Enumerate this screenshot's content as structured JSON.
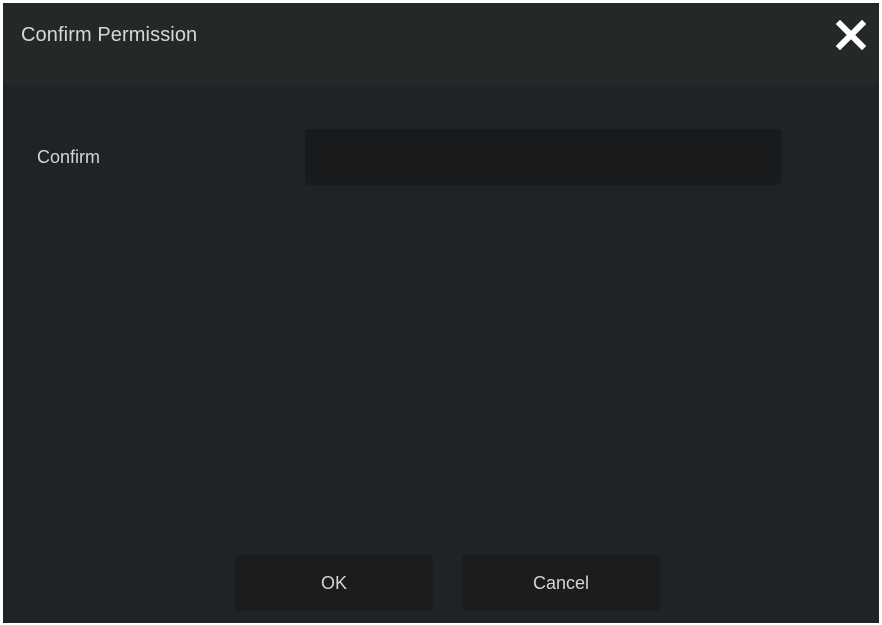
{
  "dialog": {
    "title": "Confirm Permission",
    "close_icon": "close-icon"
  },
  "form": {
    "confirm_label": "Confirm",
    "confirm_value": "",
    "confirm_placeholder": ""
  },
  "buttons": {
    "ok_label": "OK",
    "cancel_label": "Cancel"
  },
  "colors": {
    "dialog_bg": "#1f2326",
    "titlebar_bg": "#252829",
    "input_bg": "#181a1c",
    "button_bg": "#1a1c1e",
    "text": "#d4d4d4"
  }
}
